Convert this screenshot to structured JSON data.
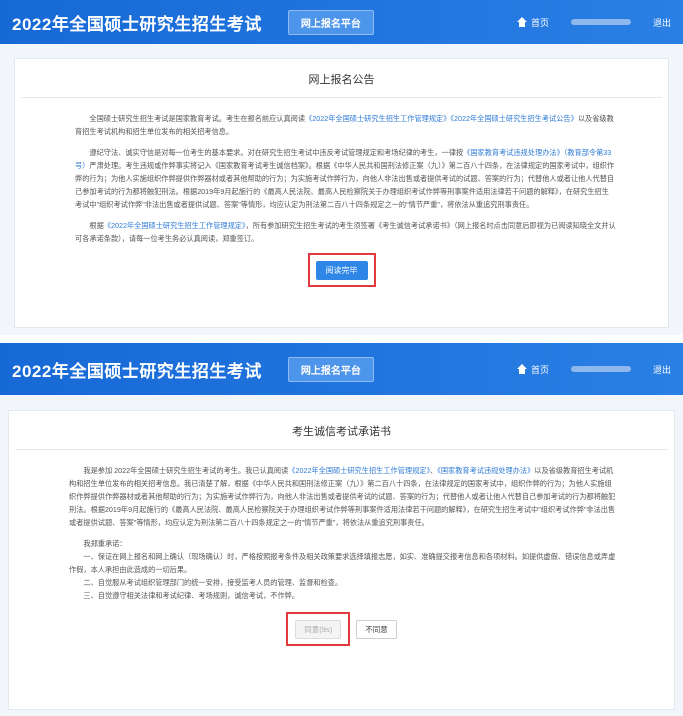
{
  "screen1": {
    "brand": "2022年全国硕士研究生招生考试",
    "platform": "网上报名平台",
    "nav": {
      "home": "首页",
      "logout": "退出"
    },
    "card_title": "网上报名公告",
    "p1_a": "全国硕士研究生招生考试是国家教育考试。考生在报名前应认真阅读",
    "p1_link1": "《2022年全国硕士研究生招生工作管理规定》",
    "p1_link2": "《2022年全国硕士研究生招生考试公告》",
    "p1_b": "以及省级教育招生考试机构和招生单位发布的相关招考信息。",
    "p2_a": "遵纪守法、诚实守信是对每一位考生的基本要求。对在研究生招生考试中违反考试管理规定和考场纪律的考生，一律按",
    "p2_link1": "《国家教育考试违规处理办法》（教育部令第33号）",
    "p2_b": "严肃处理。考生违规或作弊事实将记入《国家教育考试考生诚信档案》。根据《中华人民共和国刑法修正案（九）》第二百八十四条，在法律规定的国家考试中，组织作弊的行为；为他人实施组织作弊提供作弊器材或者其他帮助的行为；为实施考试作弊行为，向他人非法出售或者提供考试的试题、答案的行为；代替他人或者让他人代替自己参加考试的行为都将触犯刑法。根据2019年9月起施行的《最高人民法院、最高人民检察院关于办理组织考试作弊等刑事案件适用法律若干问题的解释》，在研究生招生考试中\"组织考试作弊\"非法出售或者提供试题、答案\"等情形，均应认定为刑法第二百八十四条规定之一的\"情节严重\"，将依法从重追究刑事责任。",
    "p3_a": "根据",
    "p3_link1": "《2022年全国硕士研究生招生工作管理规定》",
    "p3_b": "，所有参加研究生招生考试的考生须签署《考生诚信考试承诺书》（网上报名时点击同意后即视为已阅读知晓全文并认可各承诺条款），请每一位考生务必认真阅读，郑重签订。",
    "button": "阅读完毕"
  },
  "screen2": {
    "brand": "2022年全国硕士研究生招生考试",
    "platform": "网上报名平台",
    "nav": {
      "home": "首页",
      "logout": "退出"
    },
    "card_title": "考生诚信考试承诺书",
    "p1_a": "我是参加 2022年全国硕士研究生招生考试的考生。我已认真阅读",
    "p1_link1": "《2022年全国硕士研究生招生工作管理规定》",
    "p1_sep": "、",
    "p1_link2": "《国家教育考试违规处理办法》",
    "p1_b": "以及省级教育招生考试机构和招生单位发布的相关招考信息。我已清楚了解，根据《中华人民共和国刑法修正案（九）》第二百八十四条，在法律规定的国家考试中，组织作弊的行为；为他人实施组织作弊提供作弊器材或者其他帮助的行为；为实施考试作弊行为，向他人非法出售或者提供考试的试题、答案的行为；代替他人或者让他人代替自己参加考试的行为都将触犯刑法。根据2019年9月起施行的《最高人民法院、最高人民检察院关于办理组织考试作弊等刑事案件适用法律若干问题的解释》，在研究生招生考试中\"组织考试作弊\"非法出售或者提供试题、答案\"等情形，均应认定为刑法第二百八十四条规定之一的\"情节严重\"，将依法从重追究刑事责任。",
    "promise_head": "我郑重承诺：",
    "promise1": "一、保证在网上报名和网上确认（现场确认）时，严格按照报考条件及相关政策要求选择填报志愿，如实、准确提交报考信息和各项材料。如提供虚假、错误信息或弄虚作假，本人承担由此造成的一切后果。",
    "promise2": "二、自觉服从考试组织管理部门的统一安排，接受监考人员的管理、监督和检查。",
    "promise3": "三、自觉遵守相关法律和考试纪律、考场规则，诚信考试，不作弊。",
    "agree_button": "同意(9s)",
    "disagree_button": "不同意"
  }
}
